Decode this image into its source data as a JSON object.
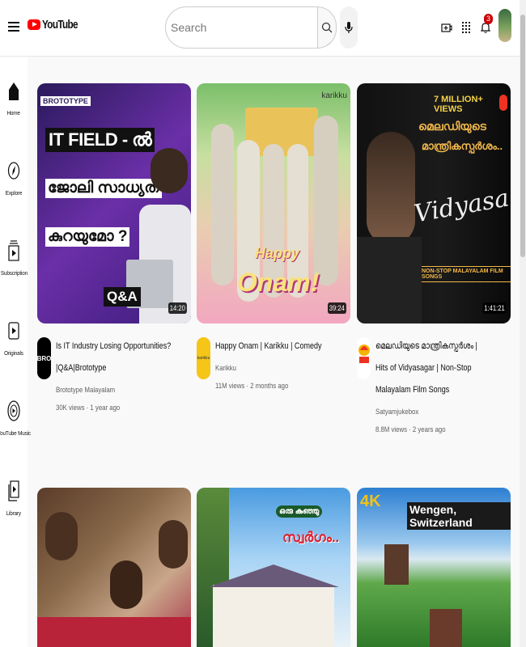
{
  "header": {
    "logo_text": "YouTube",
    "search_placeholder": "Search",
    "notification_count": "3"
  },
  "sidebar": {
    "items": [
      {
        "label": "Home",
        "icon": "home-icon"
      },
      {
        "label": "Explore",
        "icon": "compass-icon"
      },
      {
        "label": "Subscription",
        "icon": "subscriptions-icon"
      },
      {
        "label": "Originals",
        "icon": "originals-icon"
      },
      {
        "label": "YouTube Music",
        "icon": "music-icon"
      },
      {
        "label": "Library",
        "icon": "library-icon"
      }
    ]
  },
  "videos": [
    {
      "title_line1": "Is IT Industry Losing Opportunities?",
      "title_line2": "|Q&A|Brototype",
      "title_line3": "",
      "channel": "Brototype Malayalam",
      "stats": "30K views · 1 year ago",
      "duration": "14:20",
      "avatar_text": "BRO",
      "thumb_brand": "BROTOTYPE",
      "thumb_headline_1": "IT FIELD - ൽ",
      "thumb_headline_2": "ജോലി സാധ്യത",
      "thumb_headline_3": "കുറയുമോ ?",
      "thumb_tag": "Q&A"
    },
    {
      "title_line1": "Happy Onam | Karikku | Comedy",
      "title_line2": "",
      "title_line3": "",
      "channel": "Karikku",
      "stats": "11M views · 2 months ago",
      "duration": "39:24",
      "avatar_text": "karikku",
      "thumb_brand": "karikku",
      "thumb_headline_1": "Happy",
      "thumb_headline_2": "Onam!",
      "thumb_headline_3": "",
      "thumb_tag": ""
    },
    {
      "title_line1": "മെലഡിയുടെ മാന്ത്രികസ്പർശം |",
      "title_line2": "Hits of Vidyasagar | Non-Stop",
      "title_line3": "Malayalam Film Songs",
      "channel": "Satyamjukebox",
      "stats": "8.8M views · 2 years ago",
      "duration": "1:41:21",
      "avatar_text": "",
      "thumb_brand": "7 MILLION+ VIEWS",
      "thumb_headline_1": "മെലഡിയുടെ",
      "thumb_headline_2": "മാന്ത്രികസ്പർശം..",
      "thumb_headline_3": "Vidyasagar",
      "thumb_tag": "NON-STOP MALAYALAM FILM SONGS"
    },
    {
      "title_line1": "",
      "title_line2": "",
      "title_line3": "",
      "channel": "",
      "stats": "",
      "duration": "",
      "avatar_text": "",
      "thumb_brand": "",
      "thumb_headline_1": "",
      "thumb_headline_2": "",
      "thumb_headline_3": "",
      "thumb_tag": ""
    },
    {
      "title_line1": "",
      "title_line2": "",
      "title_line3": "",
      "channel": "",
      "stats": "",
      "duration": "",
      "avatar_text": "",
      "thumb_brand": "",
      "thumb_headline_1": "ഒരു കുഞ്ഞു",
      "thumb_headline_2": "സ്വർഗം..",
      "thumb_headline_3": "",
      "thumb_tag": ""
    },
    {
      "title_line1": "",
      "title_line2": "",
      "title_line3": "",
      "channel": "",
      "stats": "",
      "duration": "",
      "avatar_text": "",
      "thumb_brand": "4K",
      "thumb_headline_1": "Wengen, Switzerland",
      "thumb_headline_2": "",
      "thumb_headline_3": "",
      "thumb_tag": ""
    }
  ]
}
